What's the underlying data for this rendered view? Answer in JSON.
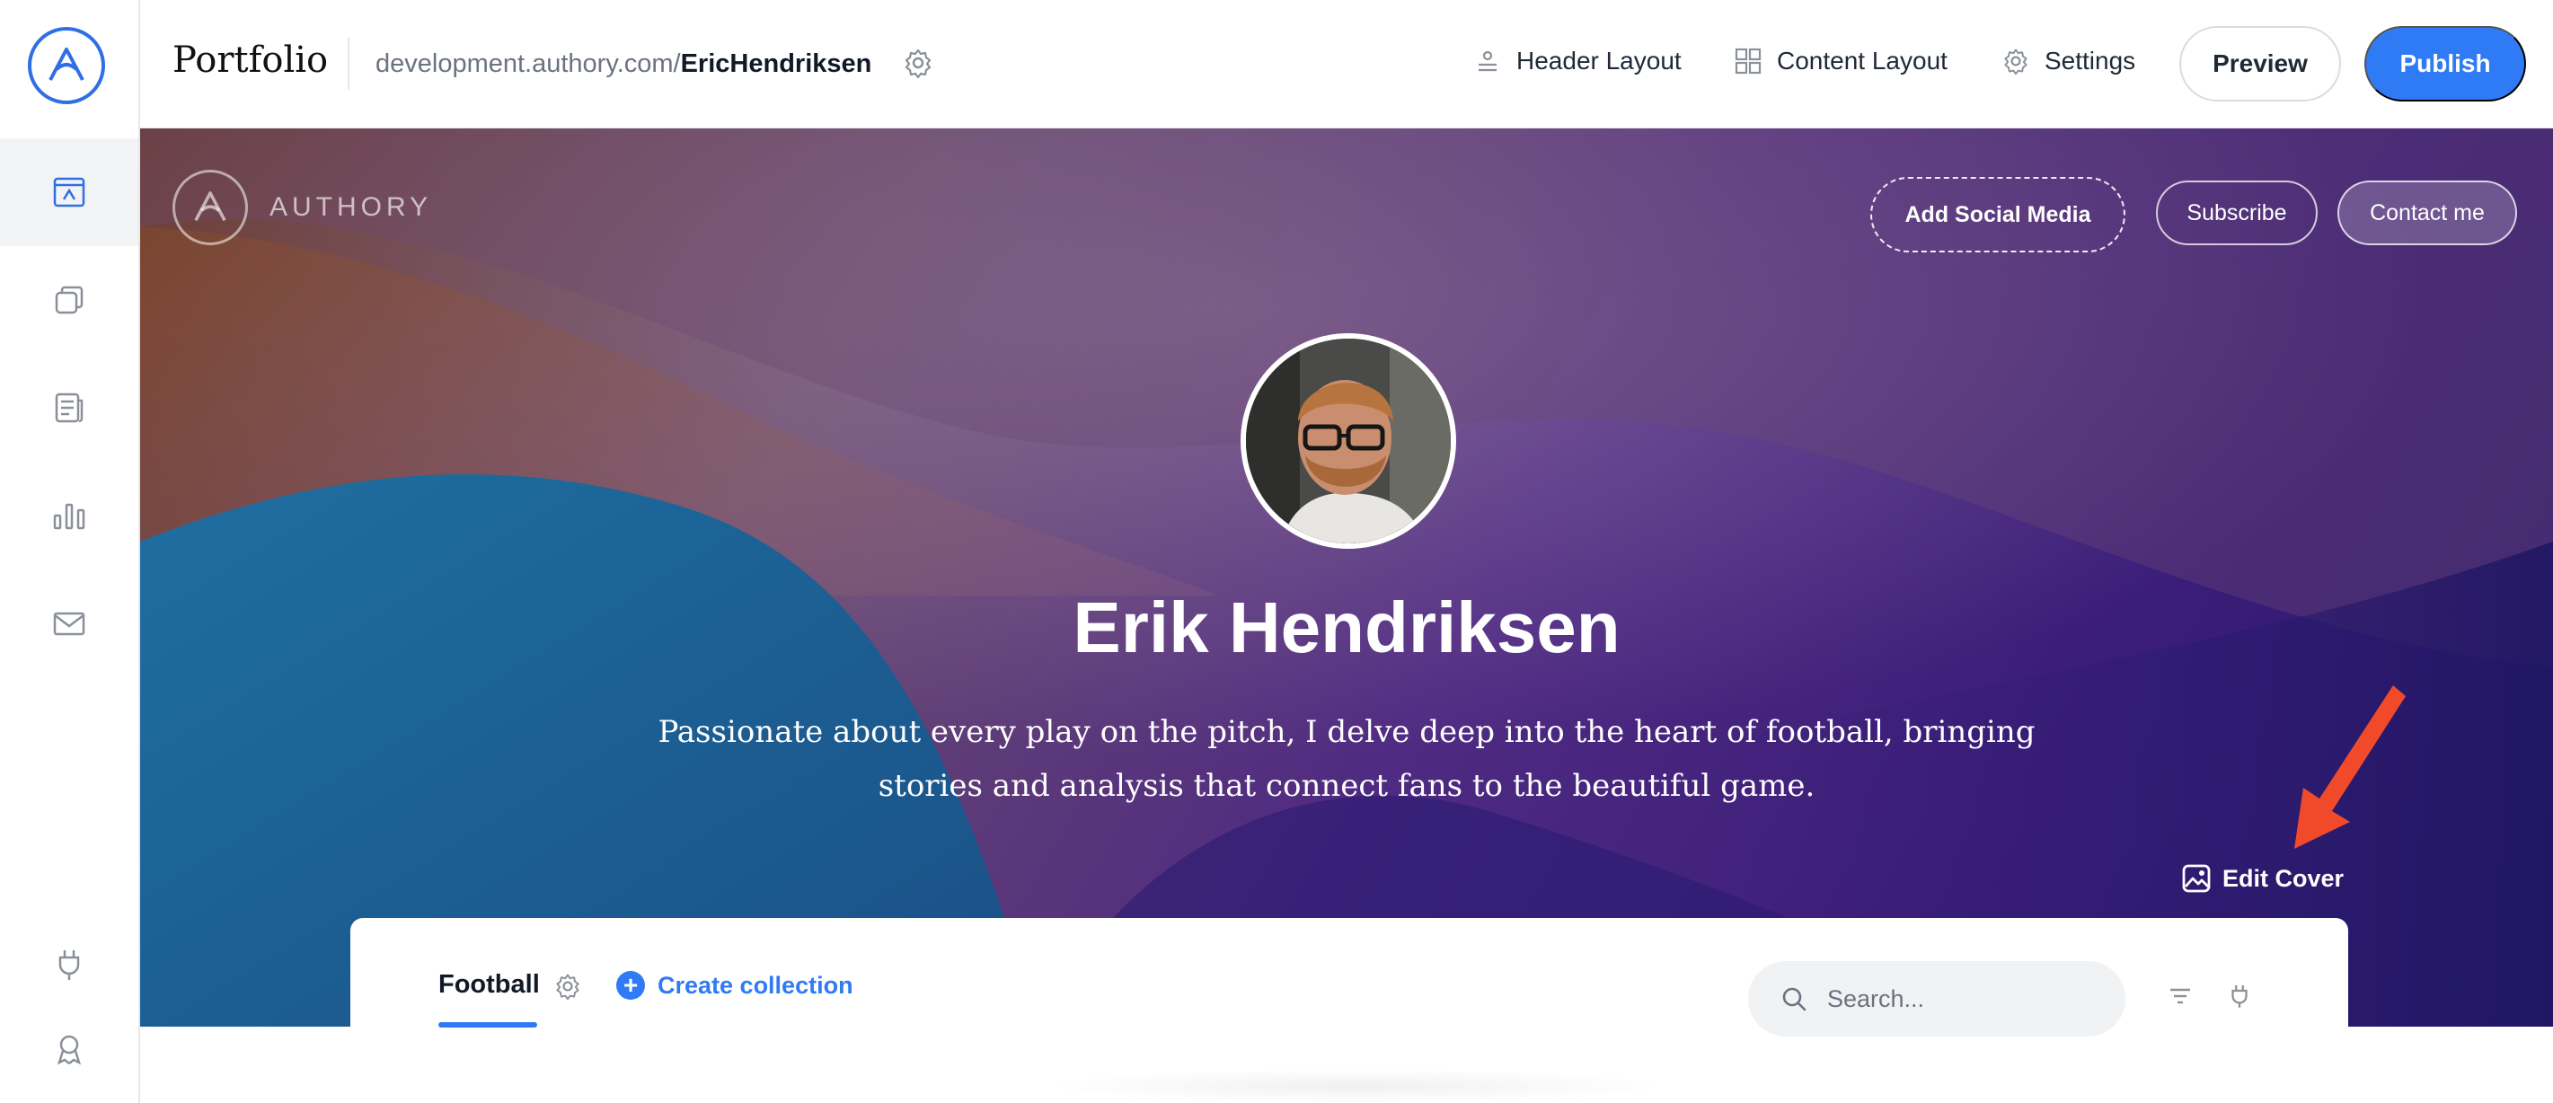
{
  "topbar": {
    "title": "Portfolio",
    "url_prefix": "development.authory.com/",
    "url_user": "EricHendriksen",
    "nav": [
      {
        "label": "Header Layout",
        "icon": "header-layout-icon"
      },
      {
        "label": "Content Layout",
        "icon": "grid-icon"
      },
      {
        "label": "Settings",
        "icon": "gear-icon"
      }
    ],
    "preview_label": "Preview",
    "publish_label": "Publish"
  },
  "sidebar": {
    "items": [
      {
        "name": "portfolio",
        "icon": "portfolio-icon",
        "active": true
      },
      {
        "name": "collections",
        "icon": "copy-icon"
      },
      {
        "name": "content",
        "icon": "article-icon"
      },
      {
        "name": "analytics",
        "icon": "bar-chart-icon"
      },
      {
        "name": "newsletter",
        "icon": "mail-icon"
      },
      {
        "name": "integrations",
        "icon": "plug-icon"
      },
      {
        "name": "achievements",
        "icon": "award-icon"
      }
    ]
  },
  "hero": {
    "brand": "AUTHORY",
    "add_social_label": "Add Social Media",
    "subscribe_label": "Subscribe",
    "contact_label": "Contact me",
    "name": "Erik Hendriksen",
    "bio": "Passionate about every play on the pitch, I delve deep into the heart of football, bringing stories and analysis that connect fans to the beautiful game.",
    "edit_cover_label": "Edit Cover",
    "annotation": "red-arrow-pointing-to-edit-cover"
  },
  "content": {
    "active_tab": "Football",
    "create_collection_label": "Create collection",
    "search_placeholder": "Search..."
  },
  "colors": {
    "accent": "#2f7bf5",
    "annotation_arrow": "#f04a2b",
    "hero_purple": "#4f2a82"
  }
}
